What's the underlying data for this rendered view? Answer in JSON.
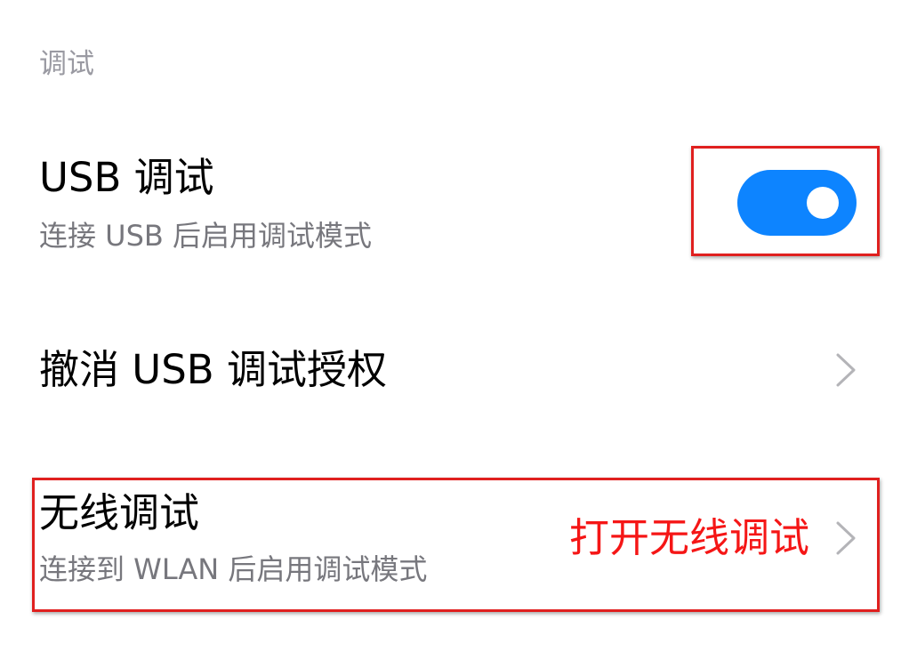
{
  "section": {
    "header": "调试"
  },
  "usb_debug": {
    "title": "USB 调试",
    "subtitle": "连接 USB 后启用调试模式",
    "enabled": true
  },
  "revoke_usb_auth": {
    "title": "撤消 USB 调试授权"
  },
  "wireless_debug": {
    "title": "无线调试",
    "subtitle": "连接到 WLAN 后启用调试模式",
    "annotation": "打开无线调试"
  },
  "colors": {
    "accent": "#0d84ff",
    "highlight": "#e0201f",
    "annotation": "#f51616"
  },
  "icons": {
    "chevron": "chevron-right-icon"
  }
}
